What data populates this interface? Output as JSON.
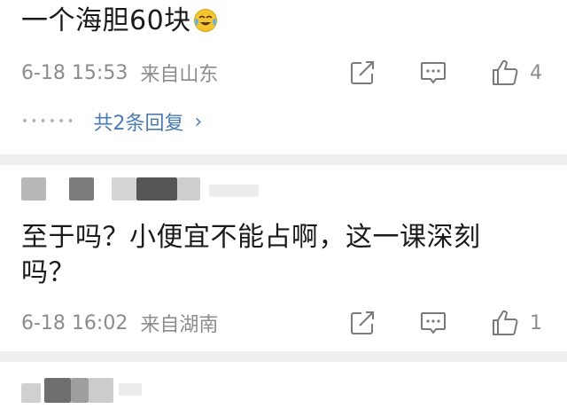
{
  "comments": [
    {
      "text": "一个海胆60块",
      "emoji_icon": "crying-laughing-emoji-icon",
      "time": "6-18 15:53",
      "location": "来自山东",
      "likes": "4",
      "replies": {
        "label": "共2条回复",
        "chevron": "›"
      }
    },
    {
      "text_line1": "至于吗？小便宜不能占啊，这一课深刻",
      "text_line2": "吗？",
      "time": "6-18 16:02",
      "location": "来自湖南",
      "likes": "1"
    }
  ],
  "icons": {
    "share": "share-icon",
    "comment": "comment-icon",
    "like": "thumbs-up-icon"
  },
  "colors": {
    "text": "#1a1a1a",
    "meta": "#8c8c8c",
    "link": "#4a7bb7",
    "divider": "#eeeeee"
  }
}
